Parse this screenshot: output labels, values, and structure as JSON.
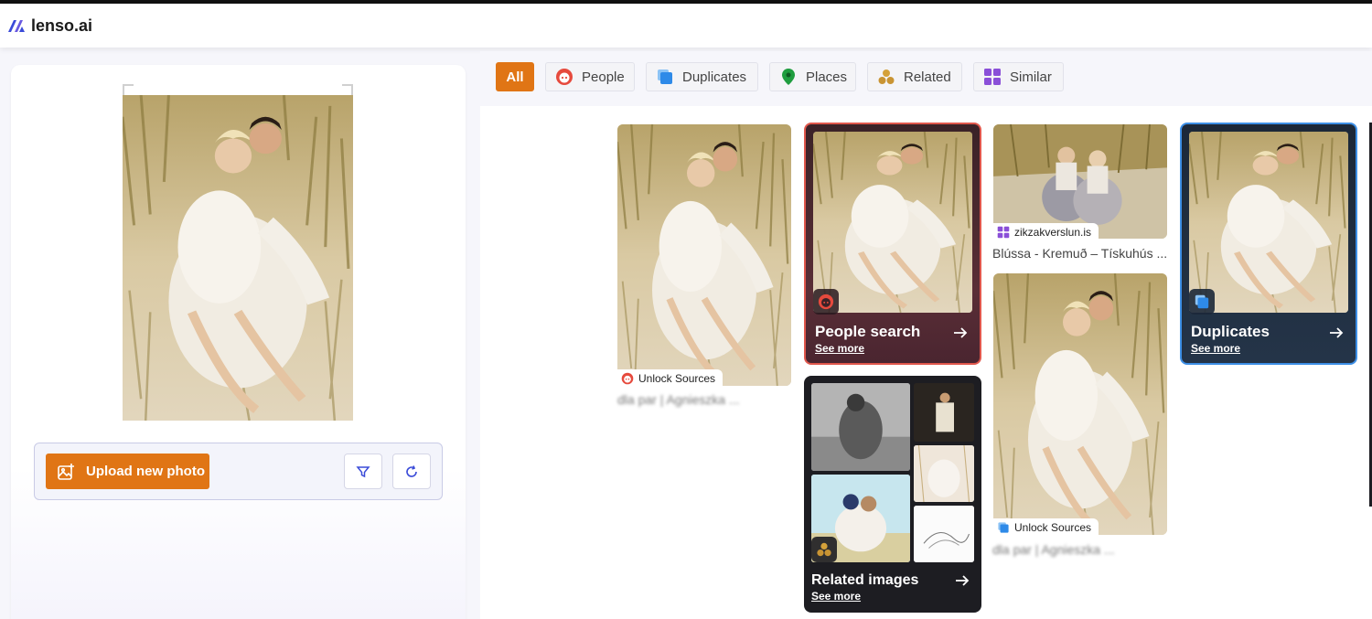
{
  "app": {
    "name": "lenso.ai"
  },
  "upload": {
    "label": "Upload new photo"
  },
  "tabs": [
    {
      "label": "All"
    },
    {
      "label": "People"
    },
    {
      "label": "Duplicates"
    },
    {
      "label": "Places"
    },
    {
      "label": "Related"
    },
    {
      "label": "Similar"
    }
  ],
  "results": {
    "result1": {
      "source": "Unlock Sources",
      "caption": "dla par | Agnieszka ..."
    },
    "result2": {
      "source": "zikzakverslun.is",
      "caption": "Blússa - Kremuð – Tískuhús ..."
    },
    "result3": {
      "source": "Unlock Sources",
      "caption": "dla par | Agnieszka ..."
    }
  },
  "features": {
    "people": {
      "title": "People search",
      "link": "See more"
    },
    "duplicates": {
      "title": "Duplicates",
      "link": "See more"
    },
    "related": {
      "title": "Related images",
      "link": "See more"
    }
  },
  "colors": {
    "accent": "#e07515",
    "people": "#e0574c",
    "duplicates": "#3d8fe6",
    "places": "#1f9d3f",
    "related": "#d4a13a",
    "similar": "#8a4fd8"
  }
}
